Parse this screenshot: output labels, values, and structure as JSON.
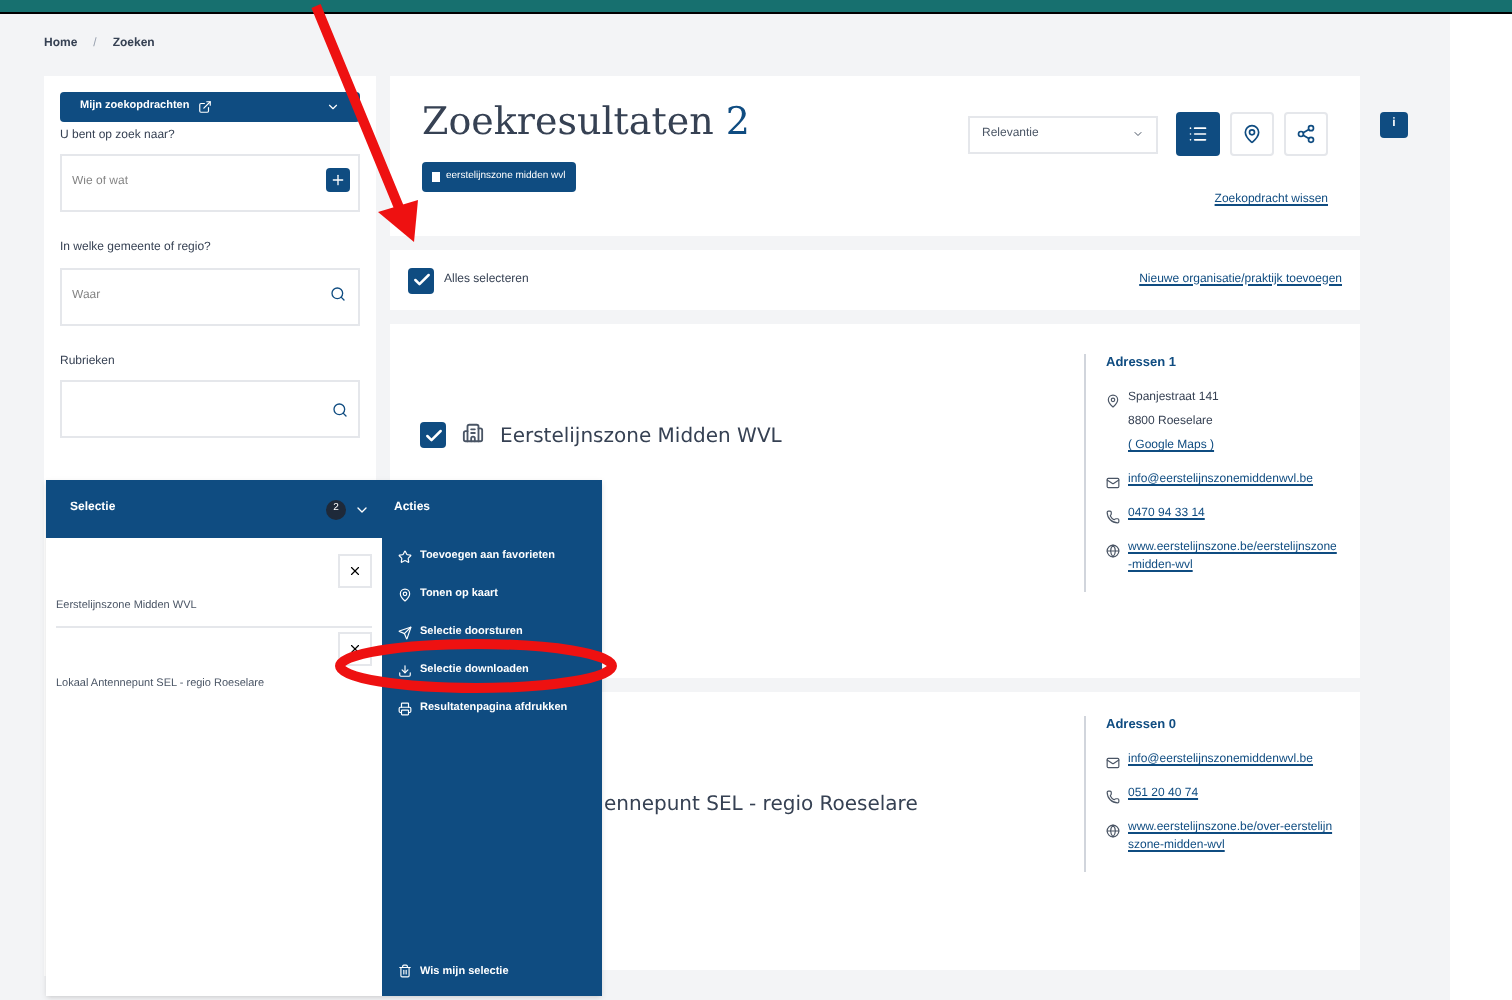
{
  "breadcrumb": [
    "Home",
    "Zoeken"
  ],
  "breadcrumb_separator": "/",
  "sidebar": {
    "my_searches_button": "Mijn zoekopdrachten",
    "what": {
      "label": "U bent op zoek naar?",
      "placeholder": "Wie of wat"
    },
    "where": {
      "label": "In welke gemeente of regio?",
      "placeholder": "Waar"
    },
    "categories": {
      "label": "Rubrieken"
    }
  },
  "header": {
    "title": "Zoekresultaten",
    "count": "2",
    "filter_tag": "eerstelijnszone midden wvl",
    "sort": "Relevantie",
    "clear_link": "Zoekopdracht wissen",
    "view_buttons": [
      {
        "kind": "list",
        "selected": true
      },
      {
        "kind": "map",
        "selected": false
      },
      {
        "kind": "share",
        "selected": false
      }
    ],
    "info_badge": "i"
  },
  "select_all": {
    "label": "Alles selecteren",
    "checked": true,
    "add_link": "Nieuwe organisatie/praktijk toevoegen"
  },
  "results": [
    {
      "name": "Eerstelijnszone Midden WVL",
      "checked": true,
      "addresses_title": "Adressen 1",
      "contacts": [
        {
          "kind": "address",
          "lines": [
            "Spanjestraat 141",
            "8800 Roeselare"
          ],
          "maps_link": "( Google Maps )"
        },
        {
          "kind": "email",
          "text": "info@eerstelijnszonemiddenwvl.be"
        },
        {
          "kind": "phone",
          "text": "0470 94 33 14"
        },
        {
          "kind": "web",
          "text": "www.eerstelijnszone.be/eerstelijnszone-midden-wvl"
        }
      ]
    },
    {
      "name": "ennepunt SEL - regio Roeselare",
      "addresses_title": "Adressen 0",
      "contacts": [
        {
          "kind": "email",
          "text": "info@eerstelijnszonemiddenwvl.be"
        },
        {
          "kind": "phone",
          "text": "051 20 40 74"
        },
        {
          "kind": "web",
          "text": "www.eerstelijnszone.be/over-eerstelijnszone-midden-wvl"
        }
      ]
    }
  ],
  "selection_panel": {
    "title": "Selectie",
    "count": "2",
    "actions_title": "Acties",
    "items": [
      "Eerstelijnszone Midden WVL",
      "Lokaal Antennepunt SEL - regio Roeselare"
    ],
    "actions": [
      {
        "kind": "favorite",
        "label": "Toevoegen aan favorieten"
      },
      {
        "kind": "map",
        "label": "Tonen op kaart"
      },
      {
        "kind": "send",
        "label": "Selectie doorsturen"
      },
      {
        "kind": "download",
        "label": "Selectie downloaden"
      },
      {
        "kind": "print",
        "label": "Resultatenpagina afdrukken"
      }
    ],
    "clear": "Wis mijn selectie"
  }
}
